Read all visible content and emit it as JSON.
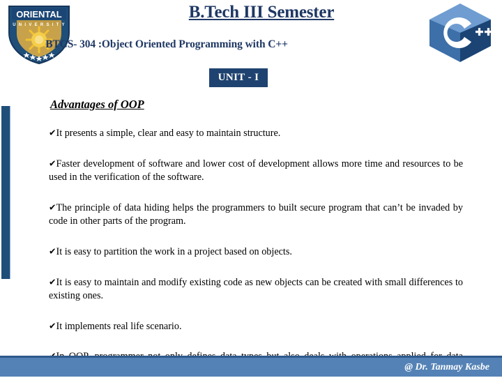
{
  "slide": {
    "header": {
      "course_level": "B.Tech III Semester",
      "course_code_title": "BTCS- 304 :Object Oriented Programming with C++",
      "university_logo_name": "ORIENTAL",
      "university_logo_subtitle": "U N I V E R S I T Y",
      "cpp_logo_letter": "C",
      "cpp_logo_plus": "++"
    },
    "unit_badge": "UNIT - I",
    "section_heading": "Advantages of OOP",
    "bullet_mark": "✔",
    "bullets": [
      "It presents a simple, clear and easy to maintain structure.",
      "Faster development of software and lower cost of development allows more time and resources to be used in the verification of the software.",
      "The principle of data hiding helps the programmers to built secure program that can’t be invaded by code in other parts of the program.",
      "It is easy to partition the work in a project based on objects.",
      "It is easy to maintain and modify existing code as new objects can be created with small differences to existing ones.",
      "It implements real life scenario.",
      "In OOP, programmer not only defines data types but also deals with operations applied for data structures."
    ],
    "footer_credit": "@ Dr. Tanmay Kasbe",
    "colors": {
      "title_navy": "#1f3864",
      "badge_navy": "#1f4370",
      "accent_bar": "#1f4e79",
      "footer_blue": "#5482b6",
      "footer_border": "#2f5a8c",
      "logo_shield_blue": "#1f4e79",
      "logo_shield_gold": "#c8a24a",
      "cpp_light_blue": "#6f9dd1",
      "cpp_mid_blue": "#3d6fa8",
      "cpp_dark_blue": "#1b4474"
    }
  }
}
